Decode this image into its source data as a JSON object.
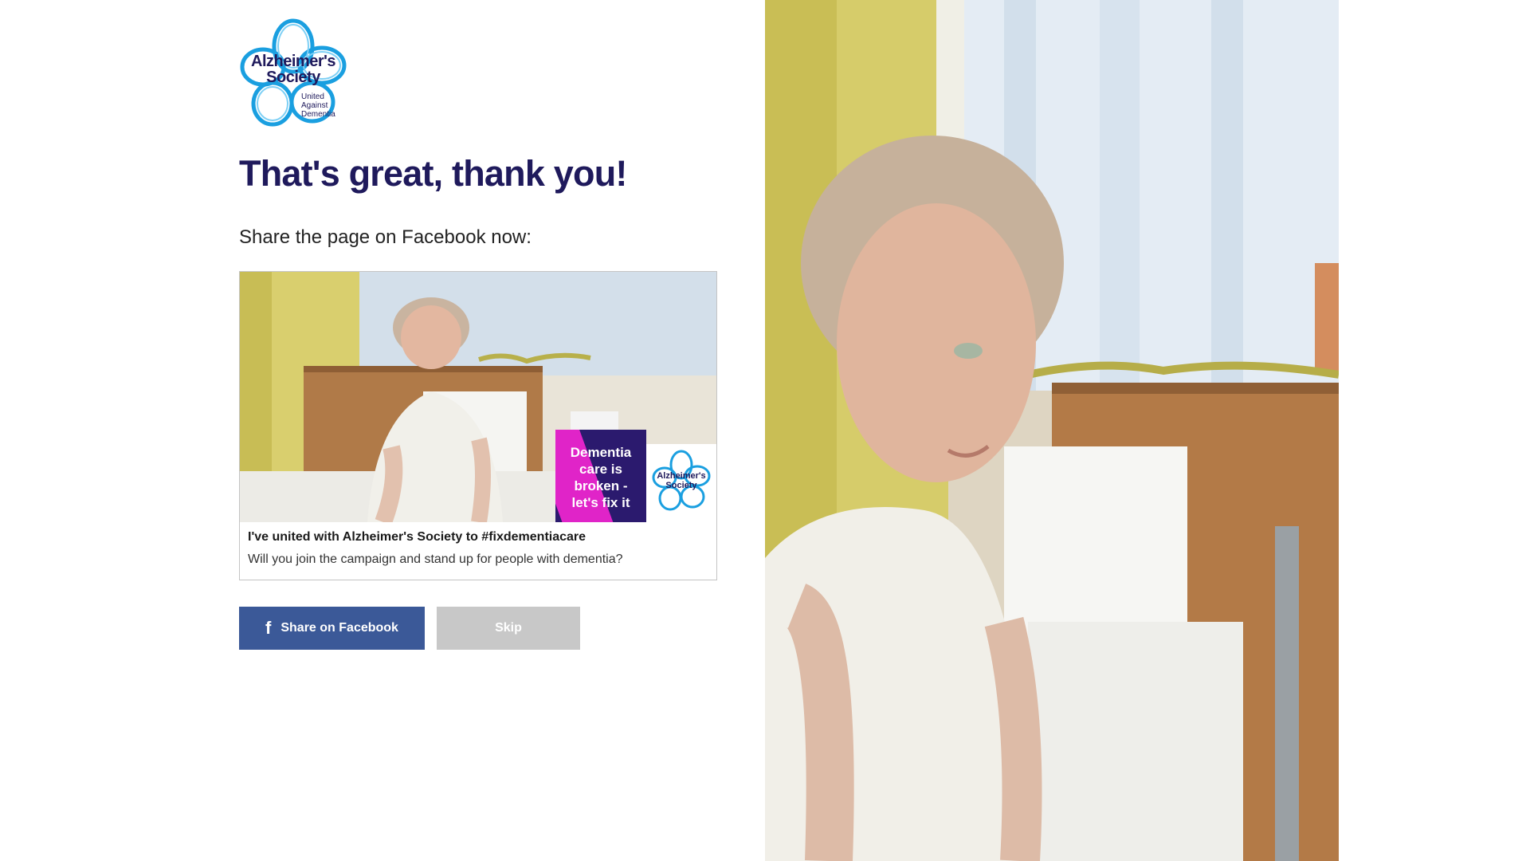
{
  "logo": {
    "name_line1": "Alzheimer's",
    "name_line2": "Society",
    "tagline_line1": "United",
    "tagline_line2": "Against",
    "tagline_line3": "Dementia",
    "colors": {
      "petal": "#1a9fe0",
      "text": "#1f1a5c"
    }
  },
  "headline": "That's great, thank you!",
  "share_prompt": "Share the page on Facebook now:",
  "preview_card": {
    "image_caption": {
      "line1": "Dementia",
      "line2": "care is",
      "line3": "broken -",
      "line4": "let's fix it"
    },
    "image_logo": {
      "line1": "Alzheimer's",
      "line2": "Society"
    },
    "title": "I've united with Alzheimer's Society to #fixdementiacare",
    "description": "Will you join the campaign and stand up for people with dementia?"
  },
  "buttons": {
    "share_facebook": "Share on Facebook",
    "facebook_icon": "facebook-icon",
    "skip": "Skip"
  },
  "colors": {
    "headline": "#1f1a5c",
    "facebook_button": "#3b5998",
    "skip_button": "#c8c8c8",
    "caption_box": "#2b1a6e",
    "caption_stripe": "#e024c8"
  }
}
